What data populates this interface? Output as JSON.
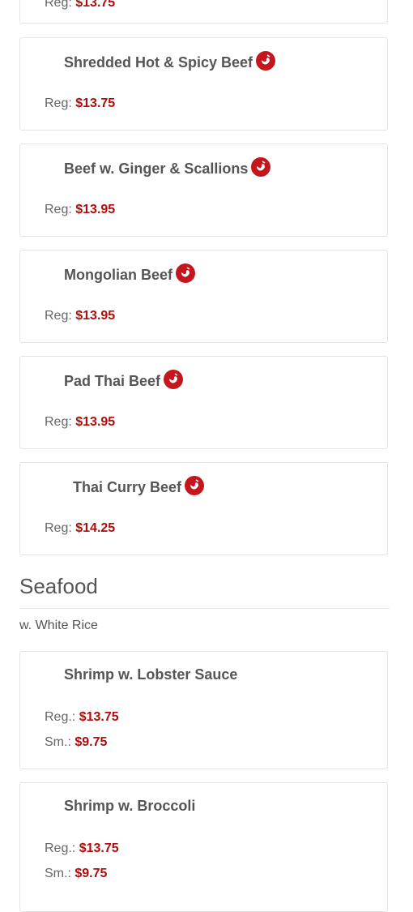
{
  "partial_top": {
    "label": "Reg:",
    "price": "$13.75"
  },
  "beef_items": [
    {
      "name": "Shredded Hot & Spicy Beef",
      "reg_label": "Reg:",
      "reg_price": "$13.75"
    },
    {
      "name": "Beef w. Ginger & Scallions",
      "reg_label": "Reg:",
      "reg_price": "$13.95"
    },
    {
      "name": "Mongolian Beef",
      "reg_label": "Reg:",
      "reg_price": "$13.95"
    },
    {
      "name": "Pad Thai Beef",
      "reg_label": "Reg:",
      "reg_price": "$13.95"
    },
    {
      "name": "Thai Curry Beef",
      "reg_label": "Reg:",
      "reg_price": "$14.25"
    }
  ],
  "seafood": {
    "title": "Seafood",
    "note": "w. White Rice",
    "items": [
      {
        "name": "Shrimp w. Lobster Sauce",
        "reg_label": "Reg.:",
        "reg_price": "$13.75",
        "sm_label": "Sm.:",
        "sm_price": "$9.75"
      },
      {
        "name": "Shrimp w. Broccoli",
        "reg_label": "Reg.:",
        "reg_price": "$13.75",
        "sm_label": "Sm.:",
        "sm_price": "$9.75"
      }
    ]
  },
  "icons": {
    "spicy": "chili-pepper-icon"
  },
  "colors": {
    "price": "#b00c0c",
    "spicy_badge": "#c4161c"
  }
}
